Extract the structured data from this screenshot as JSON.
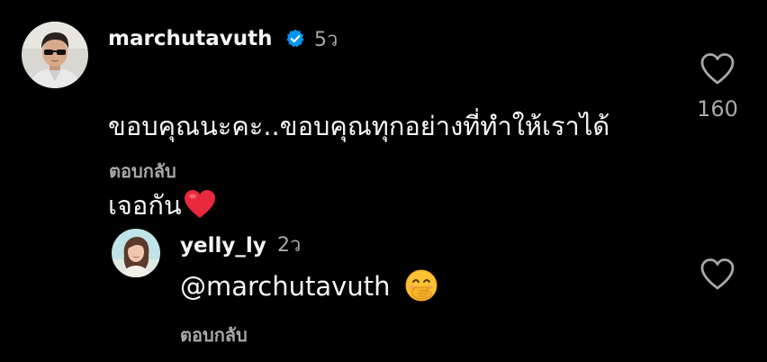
{
  "comments": [
    {
      "username": "marchutavuth",
      "verified": true,
      "timestamp": "5ว",
      "text_line1": "ขอบคุณนะคะ..ขอบคุณทุกอย่างที่ทำให้เราได้",
      "text_line2": "เจอกัน",
      "emoji": "heart-emoji",
      "reply_label": "ตอบกลับ",
      "like_count": "160",
      "avatar_icon": "avatar-man-sunglasses"
    }
  ],
  "replies": [
    {
      "username": "yelly_ly",
      "timestamp": "2ว",
      "mention": "@marchutavuth",
      "emoji": "face-with-hand-over-mouth-emoji",
      "reply_label": "ตอบกลับ",
      "avatar_icon": "avatar-woman"
    }
  ],
  "colors": {
    "background": "#000000",
    "text_primary": "#f5f5f5",
    "text_secondary": "#a8a8a8",
    "verified_blue": "#0095f6",
    "heart_red": "#e0245e"
  }
}
